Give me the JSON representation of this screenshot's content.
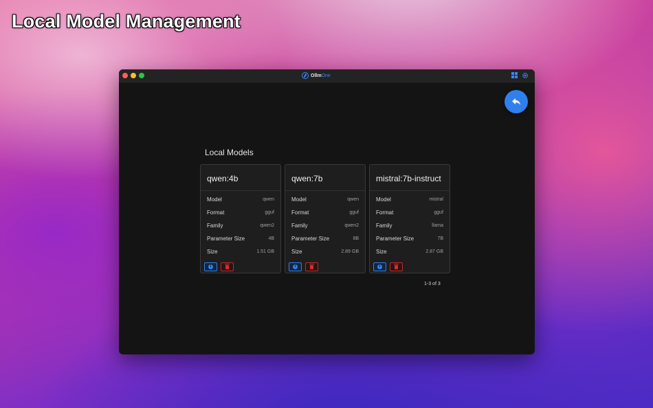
{
  "hero": {
    "title": "Local Model Management"
  },
  "window": {
    "brand_a": "Ollm",
    "brand_b": "One",
    "section_title": "Local Models",
    "pagination": "1-3 of 3"
  },
  "icons": {
    "back": "reply-arrow-icon",
    "grid": "dashboard-grid-icon",
    "gear": "gear-icon",
    "info": "info-icon",
    "delete": "trash-icon"
  },
  "colors": {
    "accent": "#2f80ed",
    "danger": "#d32f2f",
    "window_bg": "#141414"
  },
  "models": [
    {
      "name": "qwen:4b",
      "rows": [
        {
          "label": "Model",
          "value": "qwen"
        },
        {
          "label": "Format",
          "value": "gguf"
        },
        {
          "label": "Family",
          "value": "qwen2"
        },
        {
          "label": "Parameter Size",
          "value": "4B"
        },
        {
          "label": "Size",
          "value": "1.51 GB"
        }
      ]
    },
    {
      "name": "qwen:7b",
      "rows": [
        {
          "label": "Model",
          "value": "qwen"
        },
        {
          "label": "Format",
          "value": "gguf"
        },
        {
          "label": "Family",
          "value": "qwen2"
        },
        {
          "label": "Parameter Size",
          "value": "8B"
        },
        {
          "label": "Size",
          "value": "2.89 GB"
        }
      ]
    },
    {
      "name": "mistral:7b-instruct",
      "rows": [
        {
          "label": "Model",
          "value": "mistral"
        },
        {
          "label": "Format",
          "value": "gguf"
        },
        {
          "label": "Family",
          "value": "llama"
        },
        {
          "label": "Parameter Size",
          "value": "7B"
        },
        {
          "label": "Size",
          "value": "2.87 GB"
        }
      ]
    }
  ]
}
